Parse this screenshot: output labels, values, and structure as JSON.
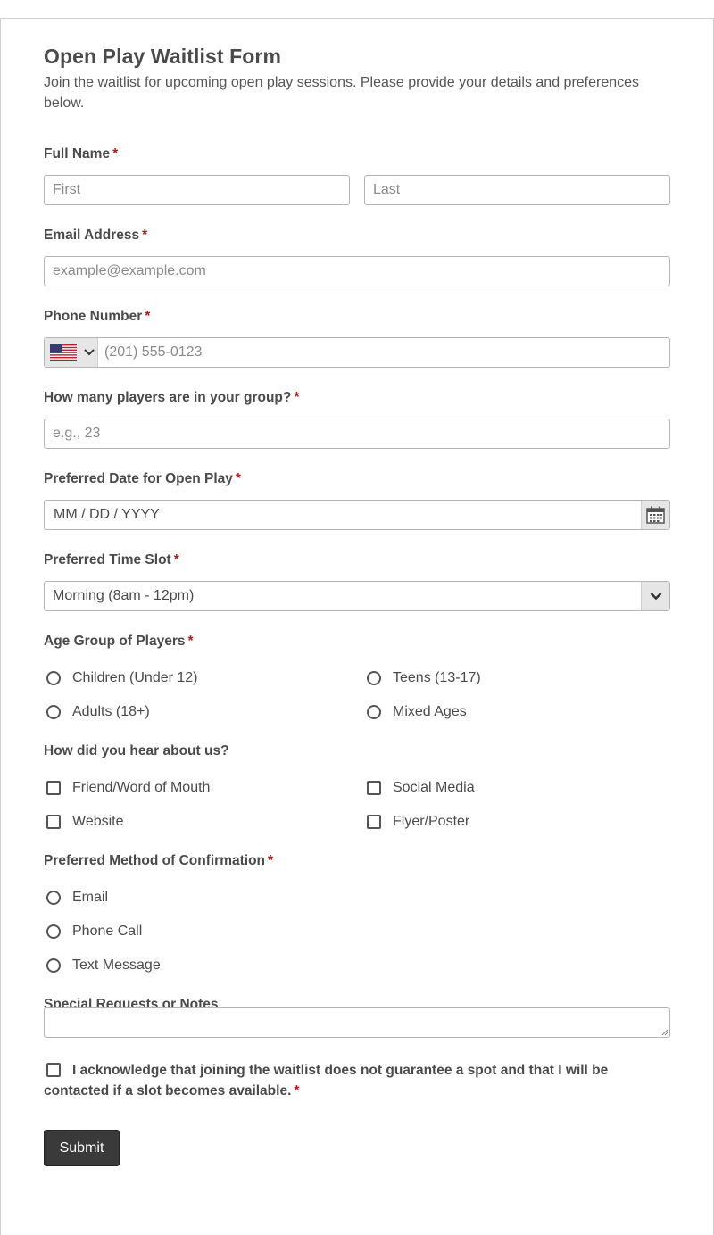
{
  "form": {
    "title": "Open Play Waitlist Form",
    "description": "Join the waitlist for upcoming open play sessions. Please provide your details and preferences below."
  },
  "required_mark": "*",
  "full_name": {
    "label": "Full Name",
    "first_placeholder": "First",
    "last_placeholder": "Last"
  },
  "email": {
    "label": "Email Address",
    "placeholder": "example@example.com"
  },
  "phone": {
    "label": "Phone Number",
    "placeholder": "(201) 555-0123",
    "country_flag": "us-flag-icon"
  },
  "players": {
    "label": "How many players are in your group?",
    "placeholder": "e.g., 23"
  },
  "date": {
    "label": "Preferred Date for Open Play",
    "placeholder": "MM / DD / YYYY"
  },
  "time_slot": {
    "label": "Preferred Time Slot",
    "selected": "Morning (8am - 12pm)"
  },
  "age_group": {
    "label": "Age Group of Players",
    "options": [
      "Children (Under 12)",
      "Teens (13-17)",
      "Adults (18+)",
      "Mixed Ages"
    ]
  },
  "heard_about": {
    "label": "How did you hear about us?",
    "options": [
      "Friend/Word of Mouth",
      "Social Media",
      "Website",
      "Flyer/Poster"
    ]
  },
  "confirmation": {
    "label": "Preferred Method of Confirmation",
    "options": [
      "Email",
      "Phone Call",
      "Text Message"
    ]
  },
  "notes": {
    "label": "Special Requests or Notes"
  },
  "acknowledge": {
    "text": "I acknowledge that joining the waitlist does not guarantee a spot and that I will be contacted if a slot becomes available."
  },
  "submit_label": "Submit",
  "colors": {
    "required": "#b01c1c",
    "button_bg": "#3a3a3a",
    "border": "#b5b5b5"
  }
}
